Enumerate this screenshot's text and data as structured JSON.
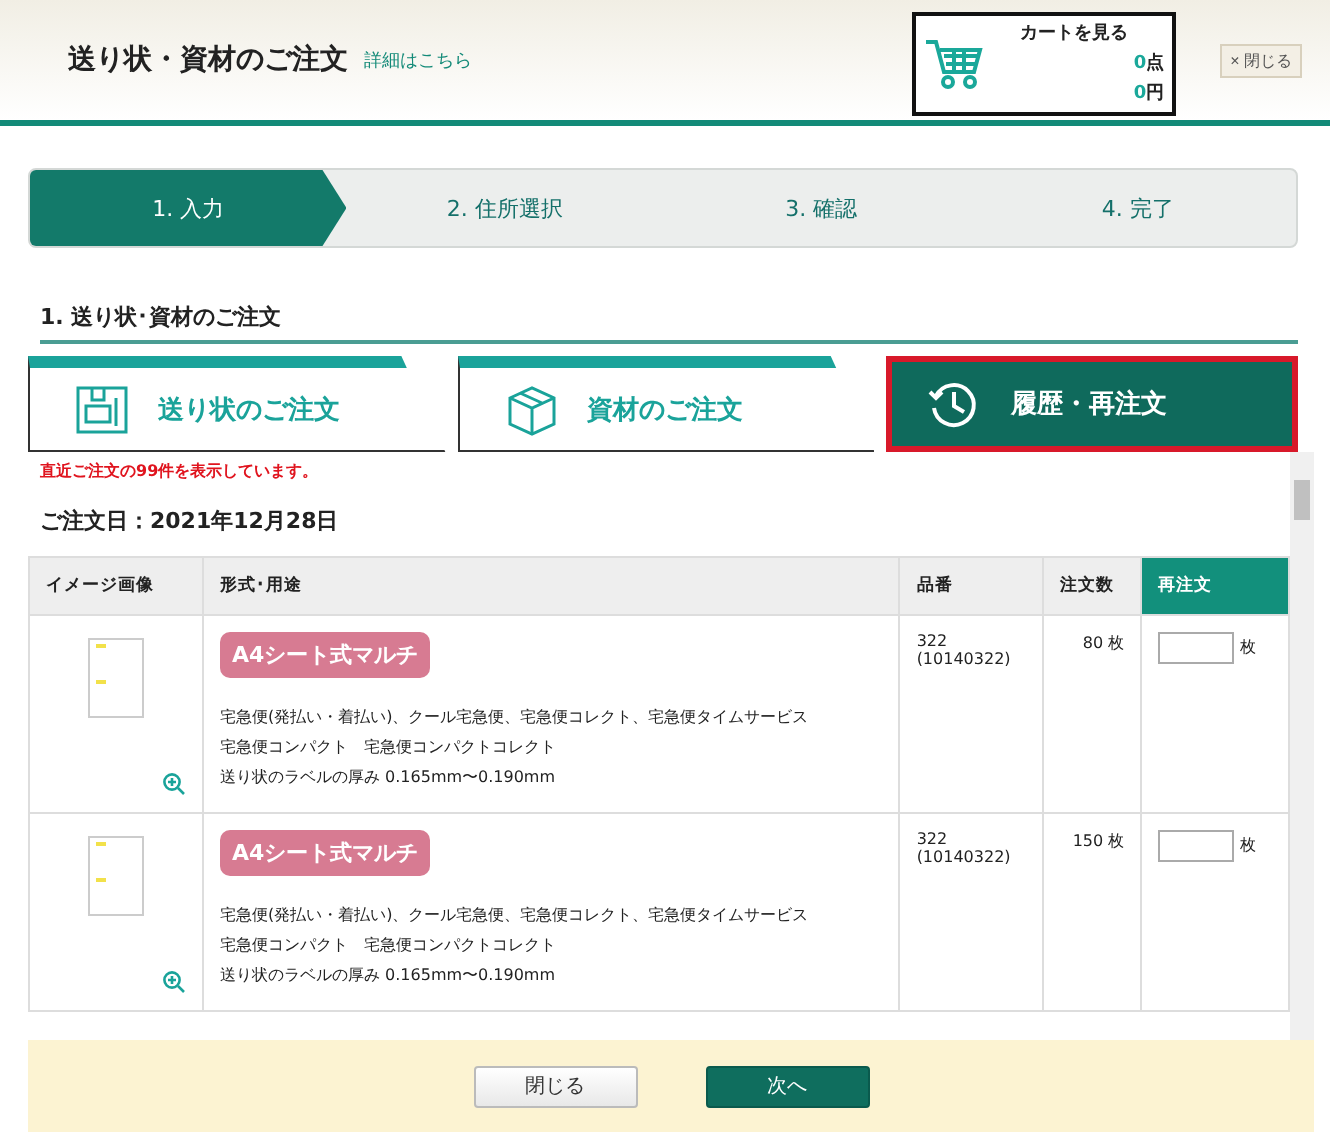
{
  "header": {
    "title": "送り状・資材のご注文",
    "detail_link": "詳細はこちら",
    "cart": {
      "label": "カートを見る",
      "count": "0",
      "count_unit": "点",
      "total": "0",
      "total_unit": "円"
    },
    "close_button": "× 閉じる"
  },
  "steps": [
    {
      "label": "1. 入力",
      "selected": true
    },
    {
      "label": "2. 住所選択",
      "selected": false
    },
    {
      "label": "3. 確認",
      "selected": false
    },
    {
      "label": "4. 完了",
      "selected": false
    }
  ],
  "section_title": "1. 送り状･資材のご注文",
  "tabs": [
    {
      "label": "送り状のご注文",
      "kind": "label",
      "selected": false
    },
    {
      "label": "資材のご注文",
      "kind": "box",
      "selected": false
    },
    {
      "label": "履歴・再注文",
      "kind": "history",
      "selected": true
    }
  ],
  "notice": "直近ご注文の99件を表示しています。",
  "order_date": "ご注文日：2021年12月28日",
  "table": {
    "columns": [
      "イメージ画像",
      "形式･用途",
      "品番",
      "注文数",
      "再注文"
    ],
    "rows": [
      {
        "tag": "A4シート式マルチ",
        "usage": [
          "宅急便(発払い・着払い)、クール宅急便、宅急便コレクト、宅急便タイムサービス",
          "宅急便コンパクト　宅急便コンパクトコレクト",
          "送り状のラベルの厚み 0.165mm〜0.190mm"
        ],
        "code": "322",
        "code_sub": "(10140322)",
        "quantity": "80 枚",
        "reorder_unit": "枚"
      },
      {
        "tag": "A4シート式マルチ",
        "usage": [
          "宅急便(発払い・着払い)、クール宅急便、宅急便コレクト、宅急便タイムサービス",
          "宅急便コンパクト　宅急便コンパクトコレクト",
          "送り状のラベルの厚み 0.165mm〜0.190mm"
        ],
        "code": "322",
        "code_sub": "(10140322)",
        "quantity": "150 枚",
        "reorder_unit": "枚"
      }
    ]
  },
  "footer": {
    "buttons": [
      {
        "label": "閉じる",
        "kind": "secondary"
      },
      {
        "label": "次へ",
        "kind": "primary"
      }
    ]
  }
}
